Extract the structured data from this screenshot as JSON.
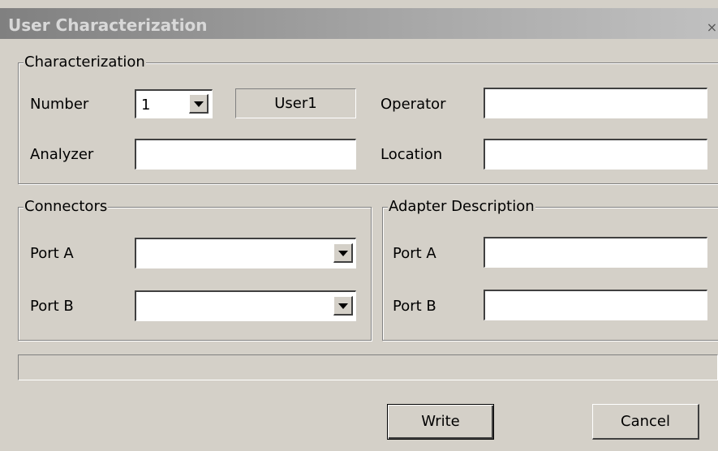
{
  "window": {
    "title": "User Characterization",
    "close_glyph": "×"
  },
  "characterization": {
    "legend": "Characterization",
    "number_label": "Number",
    "number_value": "1",
    "user_name": "User1",
    "operator_label": "Operator",
    "operator_value": "",
    "analyzer_label": "Analyzer",
    "analyzer_value": "",
    "location_label": "Location",
    "location_value": ""
  },
  "connectors": {
    "legend": "Connectors",
    "port_a_label": "Port A",
    "port_a_value": "",
    "port_b_label": "Port B",
    "port_b_value": ""
  },
  "adapter": {
    "legend": "Adapter Description",
    "port_a_label": "Port A",
    "port_a_value": "",
    "port_b_label": "Port B",
    "port_b_value": ""
  },
  "status": {
    "text": ""
  },
  "buttons": {
    "write": "Write",
    "cancel": "Cancel"
  },
  "icons": {
    "dropdown": "triangle-down",
    "close": "x"
  }
}
